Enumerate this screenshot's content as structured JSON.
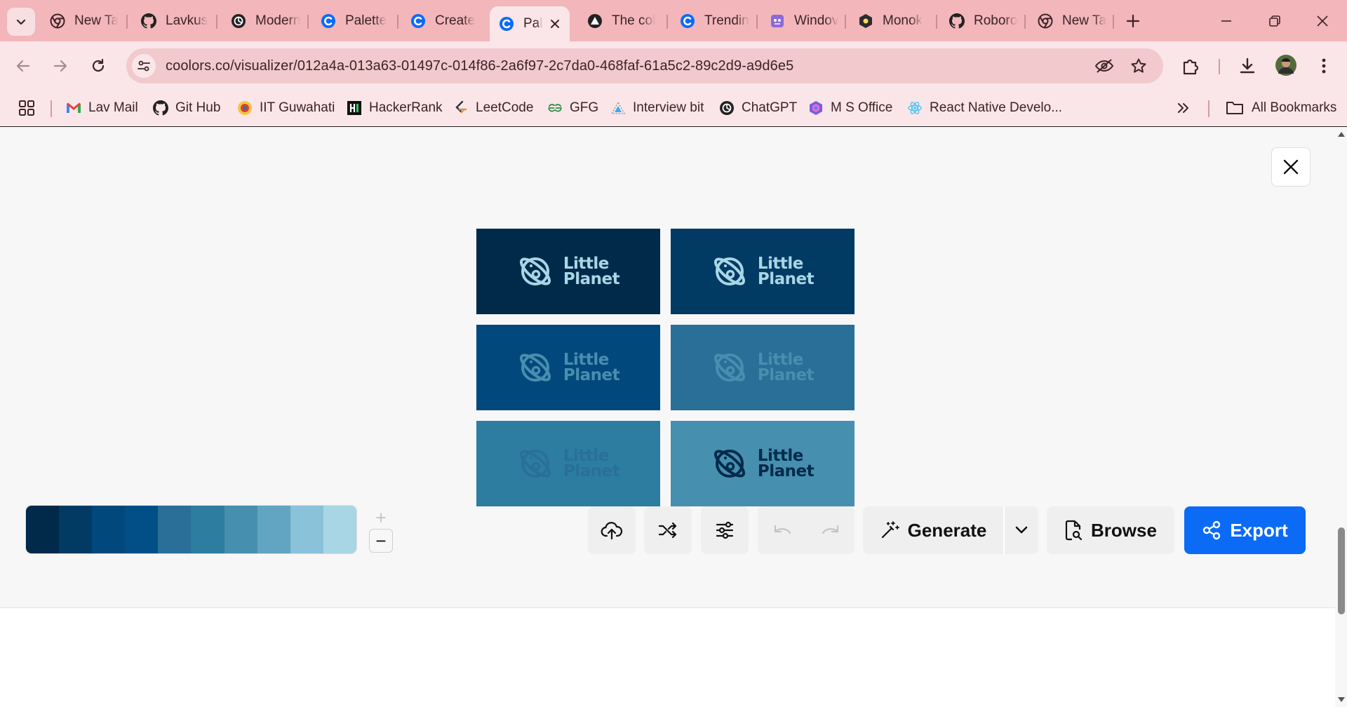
{
  "browser": {
    "tabs": [
      {
        "title": "New Ta",
        "icon": "chrome-icon"
      },
      {
        "title": "Lavkusl",
        "icon": "github-icon"
      },
      {
        "title": "Modern",
        "icon": "openai-icon"
      },
      {
        "title": "Palette",
        "icon": "coolors-icon"
      },
      {
        "title": "Create",
        "icon": "coolors-icon"
      },
      {
        "title": "Pal",
        "icon": "coolors-icon",
        "active": true
      },
      {
        "title": "The col",
        "icon": "vercel-icon"
      },
      {
        "title": "Trendin",
        "icon": "coolors-icon"
      },
      {
        "title": "Windov",
        "icon": "dracula-icon"
      },
      {
        "title": "Monok",
        "icon": "monokai-icon"
      },
      {
        "title": "Roboro",
        "icon": "github-icon"
      },
      {
        "title": "New Ta",
        "icon": "chrome-icon"
      }
    ],
    "url": "coolors.co/visualizer/012a4a-013a63-01497c-014f86-2a6f97-2c7da0-468faf-61a5c2-89c2d9-a9d6e5",
    "bookmarks": [
      {
        "label": "Lav Mail",
        "icon": "gmail-icon"
      },
      {
        "label": "Git Hub",
        "icon": "github-icon"
      },
      {
        "label": "IIT Guwahati",
        "icon": "iitg-icon"
      },
      {
        "label": "HackerRank",
        "icon": "hackerrank-icon"
      },
      {
        "label": "LeetCode",
        "icon": "leetcode-icon"
      },
      {
        "label": "GFG",
        "icon": "gfg-icon"
      },
      {
        "label": "Interview bit",
        "icon": "interviewbit-icon"
      },
      {
        "label": "ChatGPT",
        "icon": "openai-icon"
      },
      {
        "label": "M S Office",
        "icon": "office-icon"
      },
      {
        "label": "React Native Develo...",
        "icon": "react-icon"
      }
    ],
    "all_bookmarks_label": "All Bookmarks"
  },
  "visualizer": {
    "cards": [
      {
        "bg": "#012a4a",
        "fg": "#a9d6e5",
        "line1": "Little",
        "line2": "Planet"
      },
      {
        "bg": "#013a63",
        "fg": "#a9d6e5",
        "line1": "Little",
        "line2": "Planet"
      },
      {
        "bg": "#01497c",
        "fg": "#468faf",
        "line1": "Little",
        "line2": "Planet"
      },
      {
        "bg": "#2a6f97",
        "fg": "#468faf",
        "line1": "Little",
        "line2": "Planet"
      },
      {
        "bg": "#2c7da0",
        "fg": "#2a6f97",
        "line1": "Little",
        "line2": "Planet"
      },
      {
        "bg": "#468faf",
        "fg": "#012a4a",
        "line1": "Little",
        "line2": "Planet"
      }
    ]
  },
  "palette": [
    "#012a4a",
    "#013a63",
    "#01497c",
    "#014f86",
    "#2a6f97",
    "#2c7da0",
    "#468faf",
    "#61a5c2",
    "#89c2d9",
    "#a9d6e5"
  ],
  "toolbar": {
    "zoom_in": "+",
    "zoom_out": "−",
    "generate_label": "Generate",
    "browse_label": "Browse",
    "export_label": "Export",
    "accent": "#0b6bf7"
  }
}
